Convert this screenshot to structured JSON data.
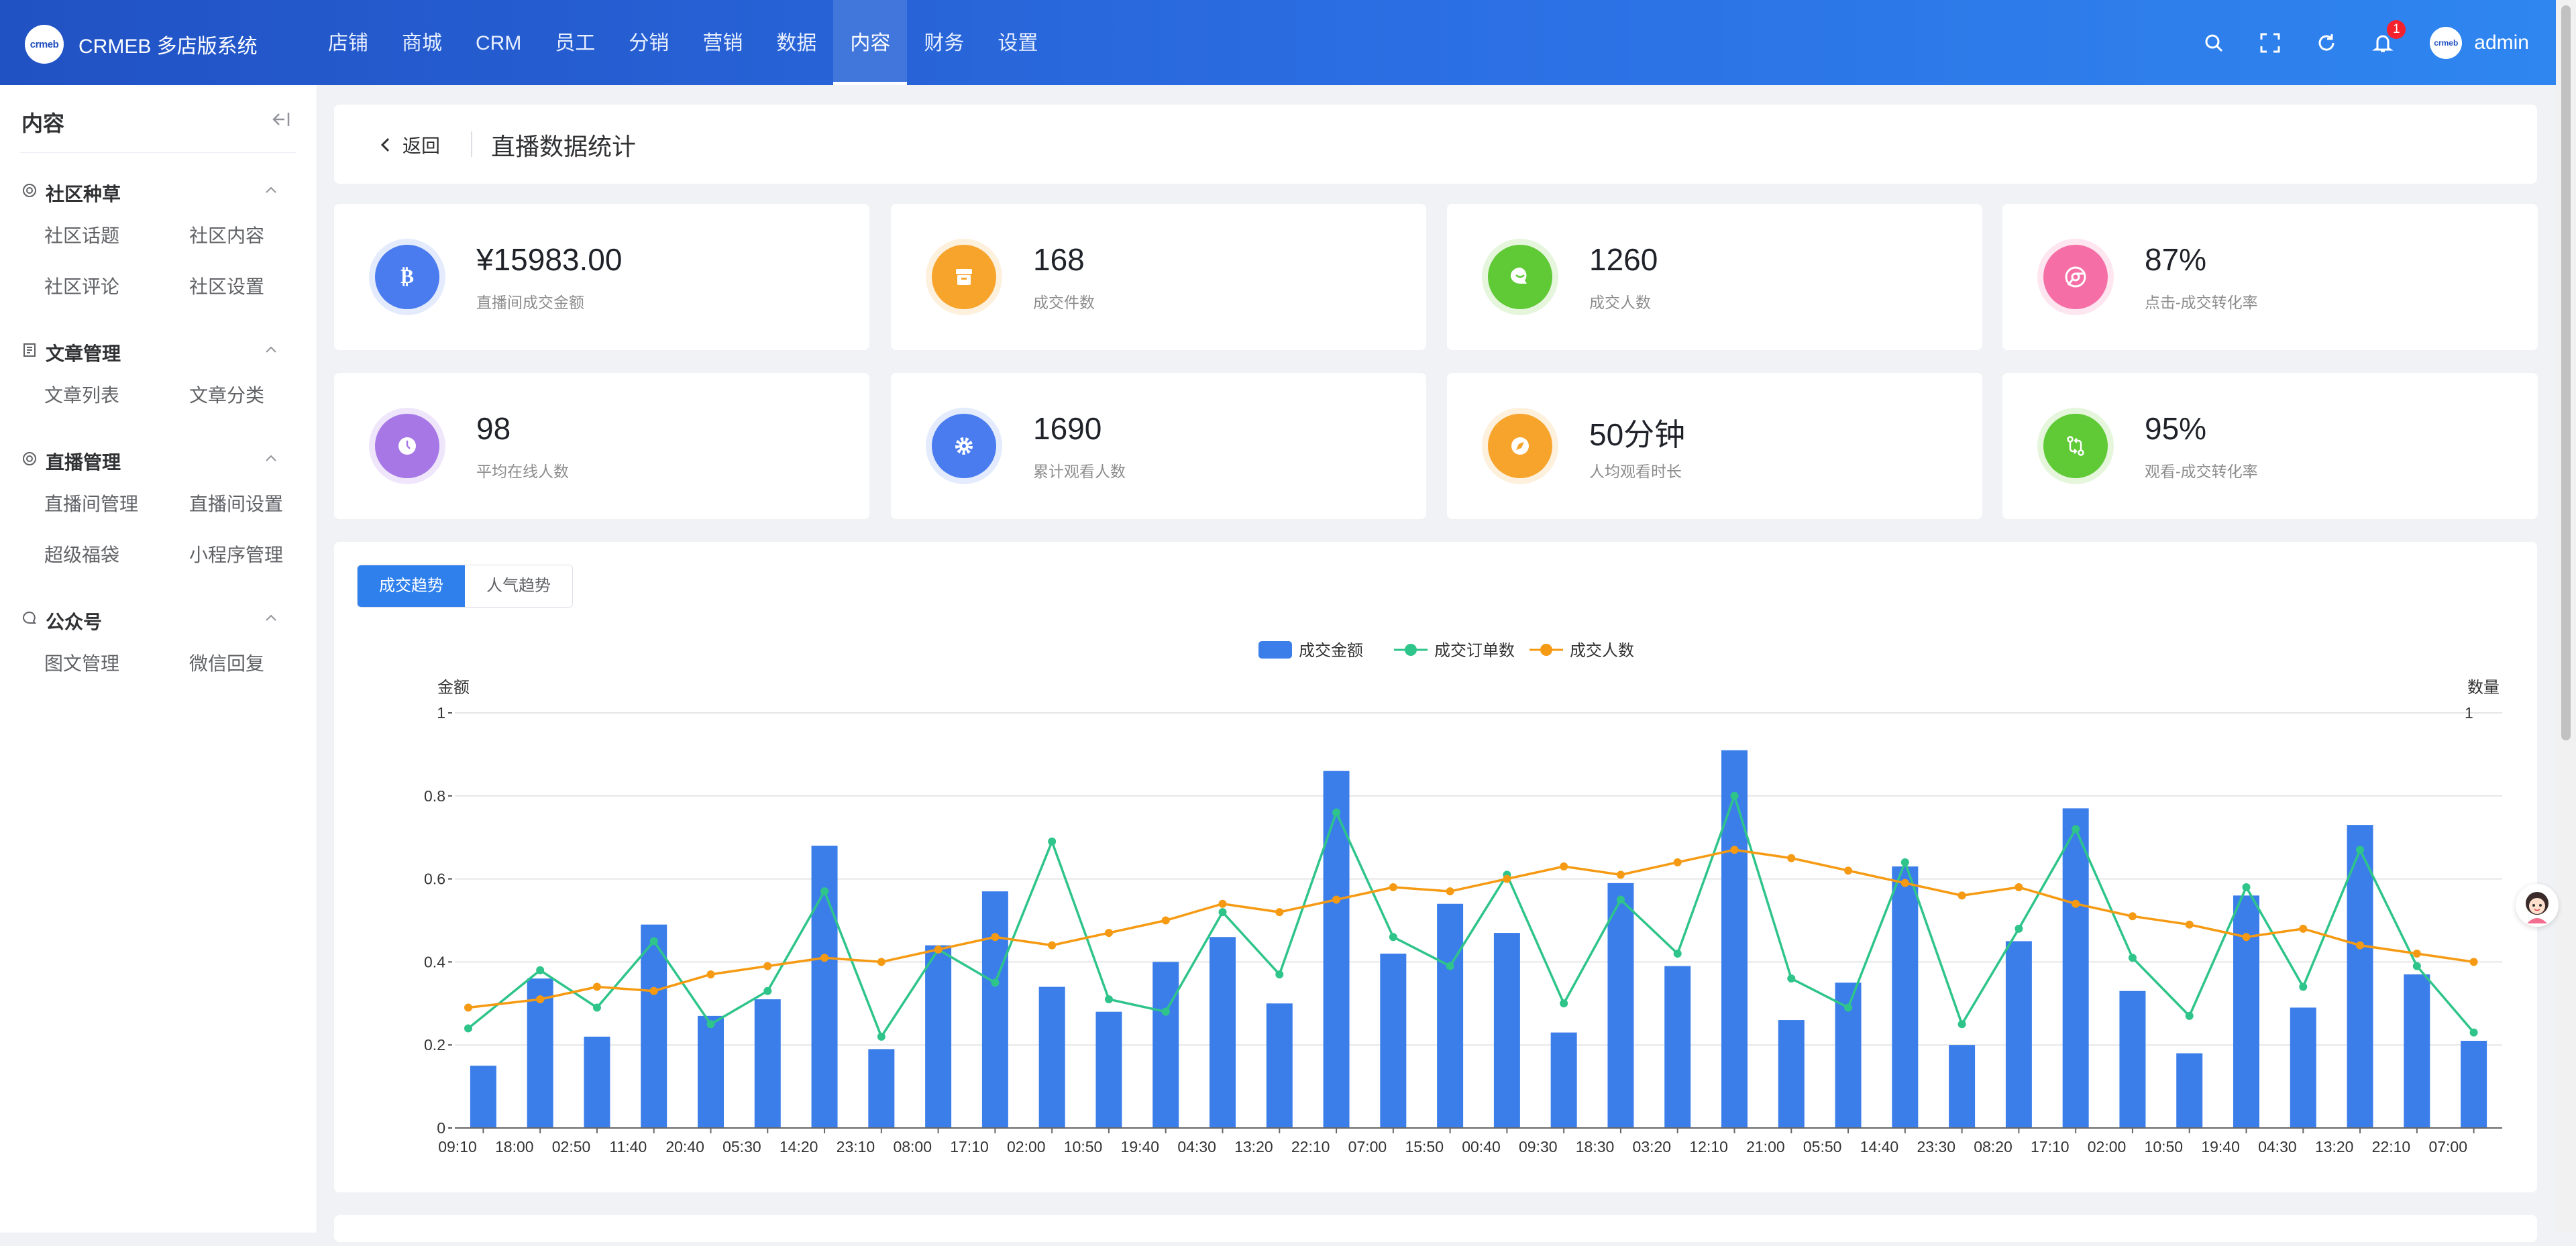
{
  "app": {
    "logo_text": "crmeb",
    "title": "CRMEB 多店版系统"
  },
  "nav": [
    {
      "label": "店铺"
    },
    {
      "label": "商城"
    },
    {
      "label": "CRM"
    },
    {
      "label": "员工"
    },
    {
      "label": "分销"
    },
    {
      "label": "营销"
    },
    {
      "label": "数据"
    },
    {
      "label": "内容",
      "active": true
    },
    {
      "label": "财务"
    },
    {
      "label": "设置"
    }
  ],
  "topbar": {
    "notification_count": "1",
    "avatar_text": "crmeb",
    "user": "admin"
  },
  "sidebar": {
    "title": "内容",
    "groups": [
      {
        "title": "社区种草",
        "icon": "target-icon",
        "items": [
          "社区话题",
          "社区内容",
          "社区评论",
          "社区设置"
        ]
      },
      {
        "title": "文章管理",
        "icon": "document-icon",
        "items": [
          "文章列表",
          "文章分类"
        ]
      },
      {
        "title": "直播管理",
        "icon": "target-icon",
        "items": [
          "直播间管理",
          "直播间设置",
          "超级福袋",
          "小程序管理"
        ]
      },
      {
        "title": "公众号",
        "icon": "chat-icon",
        "items": [
          "图文管理",
          "微信回复"
        ]
      }
    ]
  },
  "header": {
    "back": "返回",
    "title": "直播数据统计"
  },
  "stats": [
    {
      "value": "¥15983.00",
      "label": "直播间成交金额",
      "color": "#4a7cf0",
      "ring": "#e3ebfd",
      "icon": "bitcoin-icon"
    },
    {
      "value": "168",
      "label": "成交件数",
      "color": "#f7a42c",
      "ring": "#fdf0dd",
      "icon": "archive-icon"
    },
    {
      "value": "1260",
      "label": "成交人数",
      "color": "#5fc936",
      "ring": "#e5f6dd",
      "icon": "chat-bubble-icon"
    },
    {
      "value": "87%",
      "label": "点击-成交转化率",
      "color": "#f56fa6",
      "ring": "#fde6f0",
      "icon": "chrome-icon"
    },
    {
      "value": "98",
      "label": "平均在线人数",
      "color": "#a777e6",
      "ring": "#efe6fb",
      "icon": "clock-icon"
    },
    {
      "value": "1690",
      "label": "累计观看人数",
      "color": "#4a7cf0",
      "ring": "#e3ebfd",
      "icon": "gear-icon"
    },
    {
      "value": "50分钟",
      "label": "人均观看时长",
      "color": "#f7a42c",
      "ring": "#fdf0dd",
      "icon": "compass-icon"
    },
    {
      "value": "95%",
      "label": "观看-成交转化率",
      "color": "#5fc936",
      "ring": "#e5f6dd",
      "icon": "git-compare-icon"
    }
  ],
  "tabs": [
    {
      "label": "成交趋势",
      "active": true
    },
    {
      "label": "人气趋势"
    }
  ],
  "colors": {
    "bar": "#3b7eea",
    "orders": "#2ec48a",
    "people": "#f59a12"
  },
  "chart_data": {
    "type": "bar",
    "y_left_label": "金额",
    "y_right_label": "数量",
    "ylim": [
      0,
      1
    ],
    "y_ticks": [
      "0",
      "0.2",
      "0.4",
      "0.6",
      "0.8",
      "1"
    ],
    "y_right_ticks": [
      "1"
    ],
    "x": [
      "09:10",
      "18:00",
      "02:50",
      "11:40",
      "20:40",
      "05:30",
      "14:20",
      "23:10",
      "08:00",
      "17:10",
      "02:00",
      "10:50",
      "19:40",
      "04:30",
      "13:20",
      "22:10",
      "07:00",
      "15:50",
      "00:40",
      "09:30",
      "18:30",
      "03:20",
      "12:10",
      "21:00",
      "05:50",
      "14:40",
      "23:30",
      "08:20",
      "17:10",
      "02:00",
      "10:50",
      "19:40",
      "04:30",
      "13:20",
      "22:10",
      "07:00"
    ],
    "categories_count": 36,
    "series": [
      {
        "name": "成交金额",
        "type": "bar",
        "values": [
          0.15,
          0.36,
          0.22,
          0.49,
          0.27,
          0.31,
          0.68,
          0.19,
          0.44,
          0.57,
          0.34,
          0.28,
          0.4,
          0.46,
          0.3,
          0.86,
          0.42,
          0.54,
          0.47,
          0.23,
          0.59,
          0.39,
          0.91,
          0.26,
          0.35,
          0.63,
          0.2,
          0.45,
          0.77,
          0.33,
          0.18,
          0.56,
          0.29,
          0.73,
          0.37,
          0.21
        ]
      },
      {
        "name": "成交订单数",
        "type": "line",
        "values": [
          0.24,
          0.38,
          0.29,
          0.45,
          0.25,
          0.33,
          0.57,
          0.22,
          0.43,
          0.35,
          0.69,
          0.31,
          0.28,
          0.52,
          0.37,
          0.76,
          0.46,
          0.39,
          0.61,
          0.3,
          0.55,
          0.42,
          0.8,
          0.36,
          0.29,
          0.64,
          0.25,
          0.48,
          0.72,
          0.41,
          0.27,
          0.58,
          0.34,
          0.67,
          0.39,
          0.23
        ]
      },
      {
        "name": "成交人数",
        "type": "line",
        "values": [
          0.29,
          0.31,
          0.34,
          0.33,
          0.37,
          0.39,
          0.41,
          0.4,
          0.43,
          0.46,
          0.44,
          0.47,
          0.5,
          0.54,
          0.52,
          0.55,
          0.58,
          0.57,
          0.6,
          0.63,
          0.61,
          0.64,
          0.67,
          0.65,
          0.62,
          0.59,
          0.56,
          0.58,
          0.54,
          0.51,
          0.49,
          0.46,
          0.48,
          0.44,
          0.42,
          0.4
        ]
      }
    ],
    "legend_position": "top-center",
    "grid": true
  }
}
